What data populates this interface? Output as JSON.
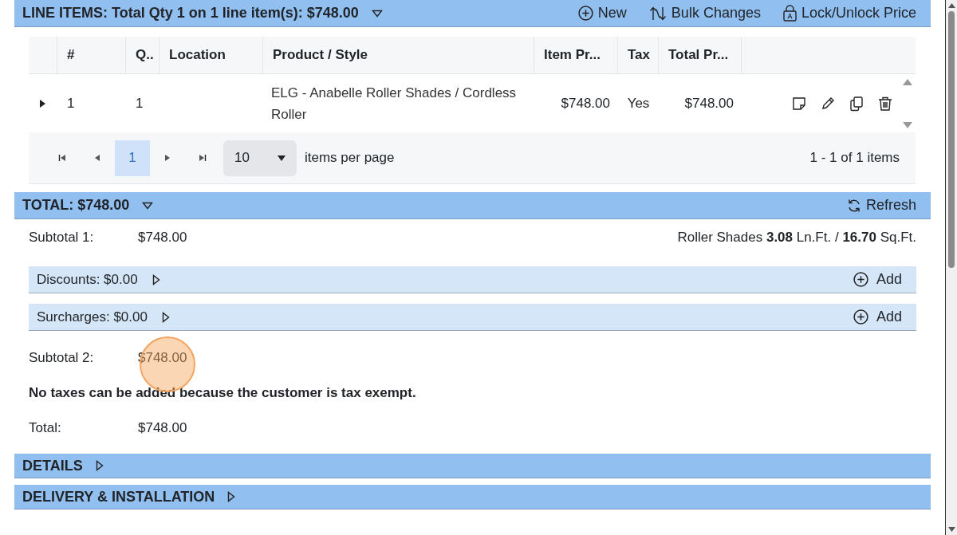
{
  "line_items": {
    "title": "LINE ITEMS: Total Qty 1 on 1 line item(s): $748.00",
    "expanded": true,
    "actions": [
      {
        "kind": "new",
        "label": "New"
      },
      {
        "kind": "bulk",
        "label": "Bulk Changes"
      },
      {
        "kind": "lock",
        "label": "Lock/Unlock Price"
      }
    ],
    "table": {
      "columns": [
        "#",
        "Q..",
        "Location",
        "Product / Style",
        "Item Pr...",
        "Tax",
        "Total Pr..."
      ],
      "rows": [
        {
          "expanded": false,
          "number": "1",
          "qty": "1",
          "product": "ELG - Anabelle Roller Shades / Cordless Roller",
          "item_price": "$748.00",
          "tax": "Yes",
          "total_price": "$748.00"
        }
      ]
    },
    "pager": {
      "pages": [
        {
          "label": "1",
          "selected": true
        }
      ],
      "page_size": "10",
      "page_size_label": "items per page",
      "summary": "1 - 1 of 1 items"
    }
  },
  "total": {
    "title": "TOTAL: $748.00",
    "expanded": true,
    "action": "Refresh",
    "subtotal_1": {
      "label": "Subtotal 1:",
      "value": "$748.00"
    },
    "measure": "Roller Shades **3.08** Ln.Ft. / **16.70** Sq.Ft.",
    "adjustments": [
      {
        "label": "Discounts: $0.00",
        "expanded": false,
        "action": "Add"
      },
      {
        "label": "Surcharges: $0.00",
        "expanded": false,
        "action": "Add"
      }
    ],
    "subtotal_2": {
      "label": "Subtotal 2:",
      "value": "$748.00"
    },
    "tax_note": "No taxes can be added because the customer is tax exempt.",
    "grand_total": {
      "label": "Total:",
      "value": "$748.00"
    }
  },
  "sections": [
    {
      "title": "DETAILS",
      "expanded": false
    },
    {
      "title": "DELIVERY & INSTALLATION",
      "expanded": false
    }
  ]
}
